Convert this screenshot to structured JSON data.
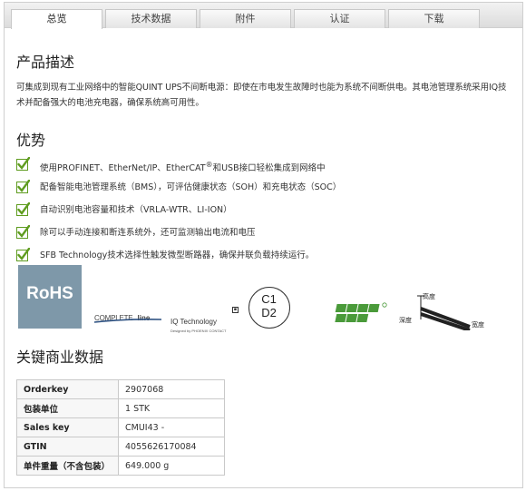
{
  "tabs": [
    {
      "label": "总览"
    },
    {
      "label": "技术数据"
    },
    {
      "label": "附件"
    },
    {
      "label": "认证"
    },
    {
      "label": "下载"
    }
  ],
  "description": {
    "heading": "产品描述",
    "text": "可集成到现有工业网络中的智能QUINT UPS不间断电源：即使在市电发生故障时也能为系统不间断供电。其电池管理系统采用IQ技术并配备强大的电池充电器，确保系统高可用性。"
  },
  "benefits": {
    "heading": "优势",
    "items": [
      {
        "pre": "使用PROFINET、EtherNet/IP、EtherCAT",
        "sup": "®",
        "post": "和USB接口轻松集成到网络中"
      },
      {
        "pre": "配备智能电池管理系统（BMS），可评估健康状态（SOH）和充电状态（SOC）",
        "sup": "",
        "post": ""
      },
      {
        "pre": "自动识别电池容量和技术（VRLA-WTR、LI-ION）",
        "sup": "",
        "post": ""
      },
      {
        "pre": "除可以手动连接和断连系统外，还可监测输出电流和电压",
        "sup": "",
        "post": ""
      },
      {
        "pre": "SFB Technology技术选择性触发微型断路器，确保并联负载持续运行。",
        "sup": "",
        "post": ""
      }
    ]
  },
  "logos": {
    "rohs": "RoHS",
    "complete_line_a": "COMPLETE",
    "complete_line_b": "line",
    "iq_tech": "IQ Technology",
    "iq_sub": "Designed by PHOENIX CONTACT",
    "c1": "C1",
    "d2": "D2",
    "dim_height": "高度",
    "dim_depth": "深度",
    "dim_width": "宽度"
  },
  "key_data": {
    "heading": "关键商业数据",
    "rows": [
      {
        "key": "Orderkey",
        "value": "2907068"
      },
      {
        "key": "包装单位",
        "value": "1 STK"
      },
      {
        "key": "Sales key",
        "value": "CMUI43 -"
      },
      {
        "key": "GTIN",
        "value": "4055626170084"
      },
      {
        "key": "单件重量（不含包装）",
        "value": "649.000 g"
      }
    ]
  },
  "colors": {
    "rohs_bg": "#7e98a9",
    "check_green": "#5f9c1f",
    "profinet_green": "#4a9a3a"
  }
}
